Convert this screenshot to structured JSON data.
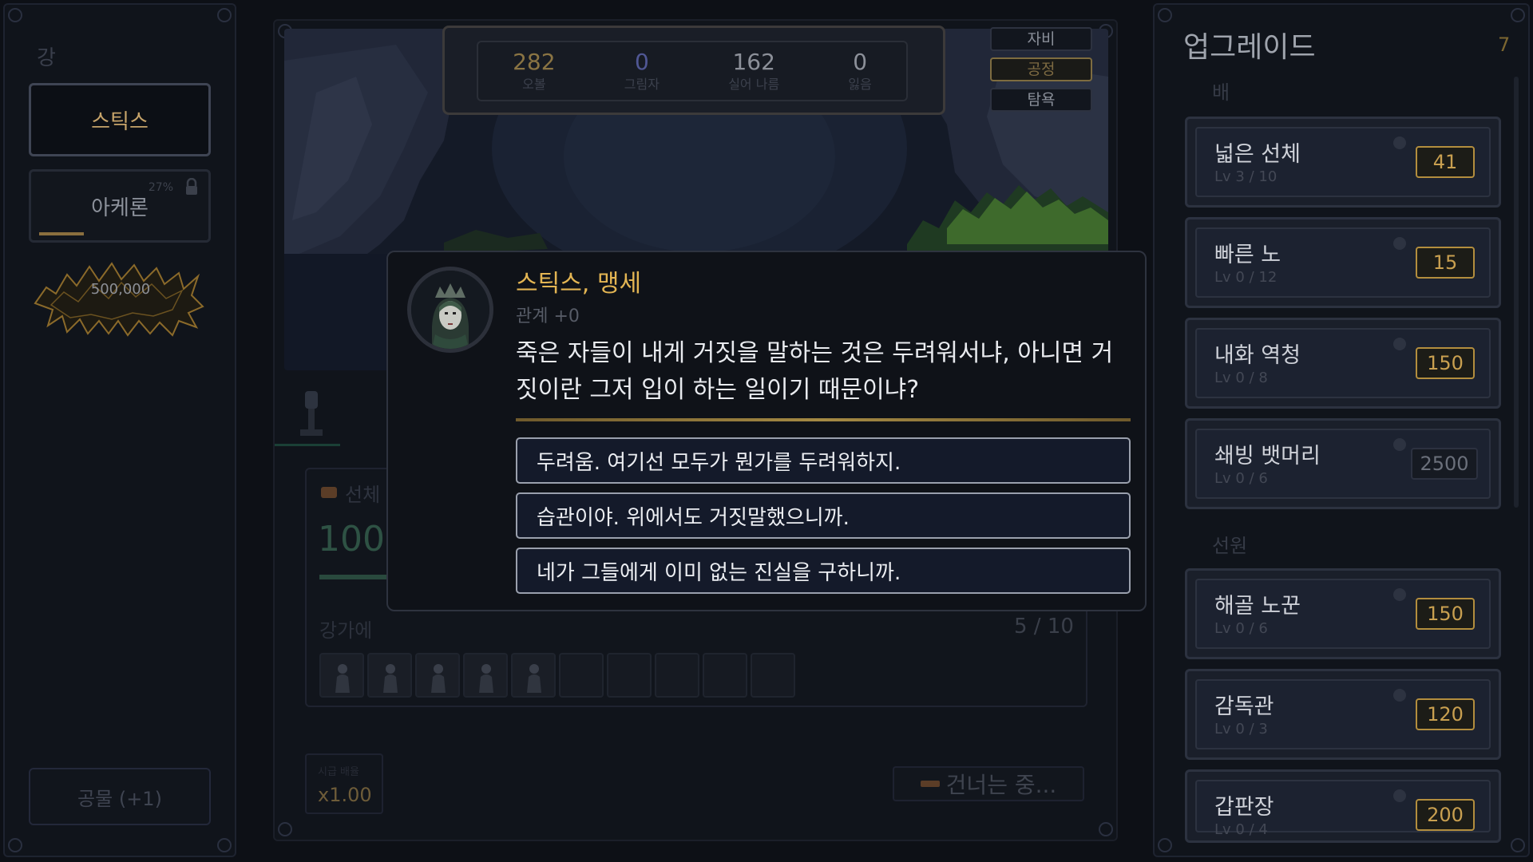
{
  "left": {
    "title": "강",
    "rivers": [
      {
        "label": "스틱스"
      },
      {
        "label": "아케론",
        "percent": "27%",
        "progress": 0.27
      }
    ],
    "threshold": "500,000",
    "tribute_button": "공물 (+1)"
  },
  "stats": [
    {
      "value": "282",
      "label": "오볼",
      "color": "#8a7443"
    },
    {
      "value": "0",
      "label": "그림자",
      "color": "#505794"
    },
    {
      "value": "162",
      "label": "실어 나름",
      "color": "#8c9099"
    },
    {
      "value": "0",
      "label": "잃음",
      "color": "#8c9099"
    }
  ],
  "modes": {
    "mercy": "자비",
    "fair": "공정",
    "greed": "탐욕"
  },
  "boat": {
    "hull_label": "선체",
    "hull_value": "100",
    "crew_label": "강가에",
    "crew_count": "5 / 10",
    "crew_filled": 5,
    "crew_slots": 10,
    "multiplier_label": "시급 배율",
    "multiplier": "x1.00",
    "status": "건너는 중..."
  },
  "dialog": {
    "speaker": "스틱스, 맹세",
    "relation": "관계 +0",
    "line": "죽은 자들이 내게 거짓을 말하는 것은 두려워서냐, 아니면 거짓이란 그저 입이 하는 일이기 때문이냐?",
    "choices": [
      "두려움. 여기선 모두가 뭔가를 두려워하지.",
      "습관이야. 위에서도 거짓말했으니까.",
      "네가 그들에게 이미 없는 진실을 구하니까."
    ]
  },
  "upgrades": {
    "title": "업그레이드",
    "count": "7",
    "sections": [
      "배",
      "선원"
    ],
    "boat": [
      {
        "name": "넓은 선체",
        "level": "Lv 3 / 10",
        "cost": "41"
      },
      {
        "name": "빠른 노",
        "level": "Lv 0 / 12",
        "cost": "15"
      },
      {
        "name": "내화 역청",
        "level": "Lv 0 / 8",
        "cost": "150"
      },
      {
        "name": "쇄빙 뱃머리",
        "level": "Lv 0 / 6",
        "cost": "2500"
      }
    ],
    "crew": [
      {
        "name": "해골 노꾼",
        "level": "Lv 0 / 6",
        "cost": "150"
      },
      {
        "name": "감독관",
        "level": "Lv 0 / 3",
        "cost": "120"
      },
      {
        "name": "갑판장",
        "level": "Lv 0 / 4",
        "cost": "200"
      }
    ]
  },
  "colors": {
    "gold": "#e3b553",
    "accent": "#b38e3e",
    "bg": "#0d1016"
  }
}
